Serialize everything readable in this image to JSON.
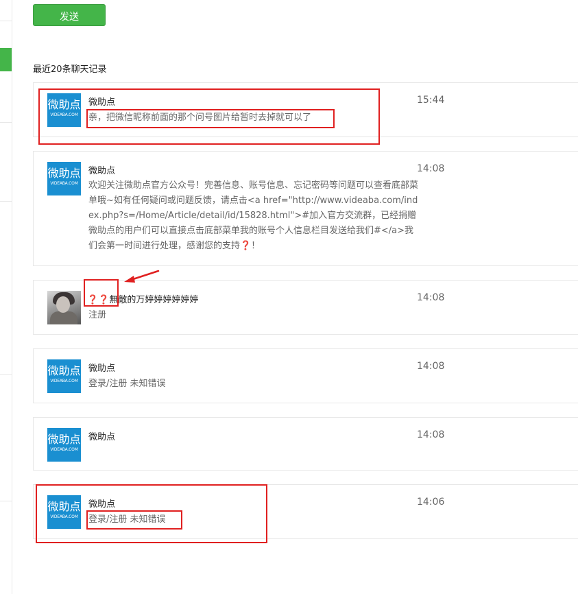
{
  "send_button": {
    "label": "发送"
  },
  "section_title": "最近20条聊天记录",
  "qmarks": "❓❓",
  "messages": [
    {
      "name": "微助点",
      "time": "15:44",
      "text": "亲，把微信昵称前面的那个问号图片给暂时去掉就可以了",
      "avatar": "logo"
    },
    {
      "name": "微助点",
      "time": "14:08",
      "text": "欢迎关注微助点官方公众号！完善信息、账号信息、忘记密码等问题可以查看底部菜单哦~如有任何疑问或问题反馈，请点击<a href=\"http://www.videaba.com/index.php?s=/Home/Article/detail/id/15828.html\">#加入官方交流群，已经捐赠微助点的用户们可以直接点击底部菜单我的账号个人信息栏目发送给我们#</a>我们会第一时间进行处理，感谢您的支持",
      "text_end": "！",
      "avatar": "logo"
    },
    {
      "name": "無敵的万婷婷婷婷婷婷",
      "time": "14:08",
      "text": "注册",
      "avatar": "photo"
    },
    {
      "name": "微助点",
      "time": "14:08",
      "text": "登录/注册 未知错误",
      "avatar": "logo"
    },
    {
      "name": "微助点",
      "time": "14:08",
      "text": "",
      "avatar": "logo"
    },
    {
      "name": "微助点",
      "time": "14:06",
      "text": "登录/注册 未知错误",
      "avatar": "logo"
    }
  ],
  "avatar_logo": {
    "main": "微助点",
    "sub": "VIDEABA.COM"
  },
  "colors": {
    "accent": "#44b549",
    "logo_bg": "#1a8fd1",
    "annotation": "#e02020",
    "question_mark": "#c40000"
  }
}
